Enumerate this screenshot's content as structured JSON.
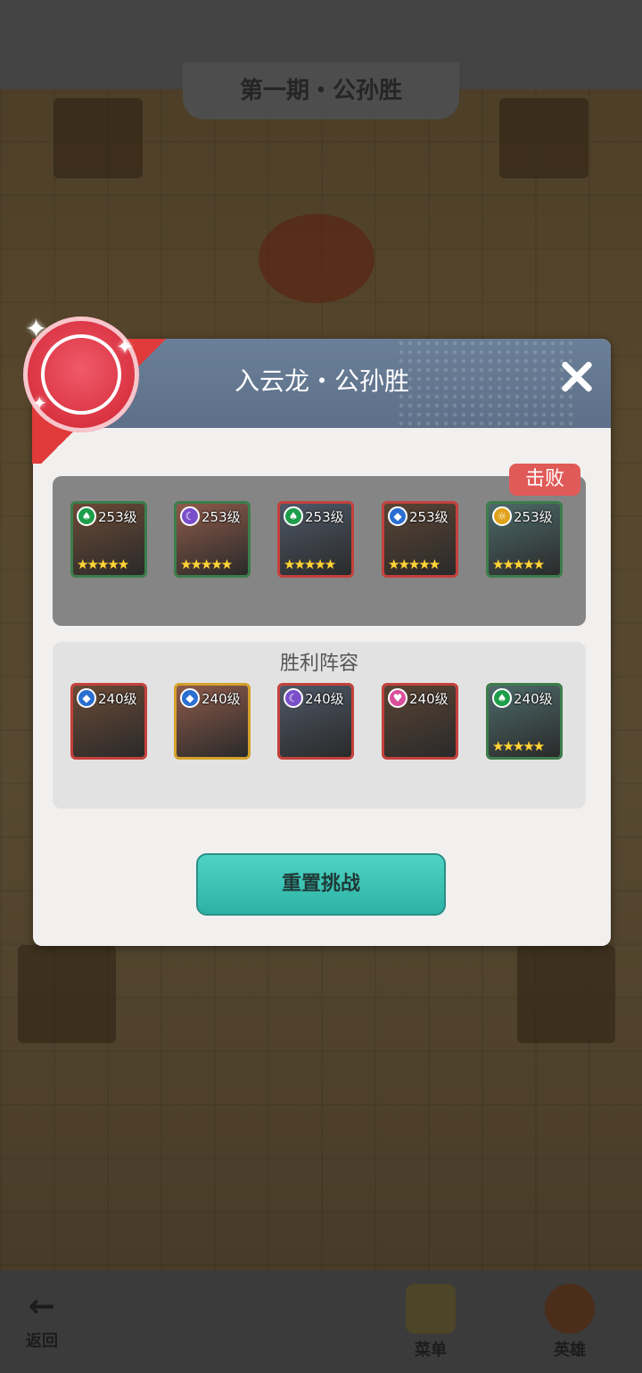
{
  "background": {
    "stage_title": "第一期・公孙胜",
    "nav": [
      {
        "label": "返回",
        "icon": "back-arrow-icon"
      },
      {
        "label": "菜单",
        "icon": "menu-icon"
      },
      {
        "label": "英雄",
        "icon": "hero-icon"
      }
    ]
  },
  "dialog": {
    "title": "入云龙・公孙胜",
    "close_icon": "close-icon",
    "defeat_badge": "击败",
    "win_lineup_title": "胜利阵容",
    "reset_button": "重置挑战",
    "enemy_heroes": [
      {
        "level": "253级",
        "element": "spade",
        "element_color": "#1e9e4a",
        "stars": "★★★★★",
        "frame": "green"
      },
      {
        "level": "253级",
        "element": "moon",
        "element_color": "#7a4fc9",
        "stars": "★★★★★",
        "frame": "green"
      },
      {
        "level": "253级",
        "element": "spade",
        "element_color": "#1e9e4a",
        "stars": "★★★★★",
        "frame": "red"
      },
      {
        "level": "253级",
        "element": "diamond",
        "element_color": "#2a6fd0",
        "stars": "★★★★★",
        "frame": "red"
      },
      {
        "level": "253级",
        "element": "sun",
        "element_color": "#e0a21a",
        "stars": "★★★★★",
        "frame": "green"
      }
    ],
    "win_heroes": [
      {
        "level": "240级",
        "element": "diamond",
        "element_color": "#2a6fd0",
        "stars": "",
        "frame": "red"
      },
      {
        "level": "240级",
        "element": "diamond",
        "element_color": "#2a6fd0",
        "stars": "",
        "frame": "gold"
      },
      {
        "level": "240级",
        "element": "moon",
        "element_color": "#7a4fc9",
        "stars": "",
        "frame": "red"
      },
      {
        "level": "240级",
        "element": "heart",
        "element_color": "#d94f9a",
        "stars": "",
        "frame": "red"
      },
      {
        "level": "240级",
        "element": "spade",
        "element_color": "#1e9e4a",
        "stars": "★★★★★",
        "frame": "green"
      }
    ]
  }
}
